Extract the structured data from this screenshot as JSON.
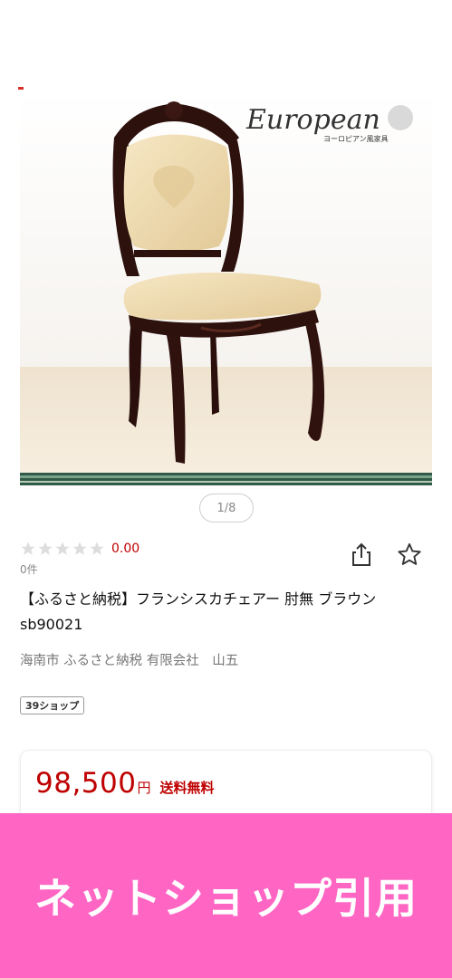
{
  "gallery": {
    "watermark_title": "European",
    "watermark_subtitle": "ヨーロピアン風家具",
    "indicator": "1/8"
  },
  "rating": {
    "stars_filled": 0,
    "stars_total": 5,
    "value": "0.00",
    "count": "0件"
  },
  "icons": {
    "share": "share-icon",
    "favorite": "star-outline-icon"
  },
  "product": {
    "title": "【ふるさと納税】フランシスカチェアー 肘無 ブラウン sb90021",
    "shop": "海南市 ふるさと納税 有限会社　山五",
    "badge": "39ショップ"
  },
  "price": {
    "amount": "98,500",
    "currency": "円",
    "shipping": "送料無料"
  },
  "banner": {
    "text": "ネットショップ引用"
  },
  "colors": {
    "accent": "#bf0000",
    "banner": "#ff66c4"
  }
}
